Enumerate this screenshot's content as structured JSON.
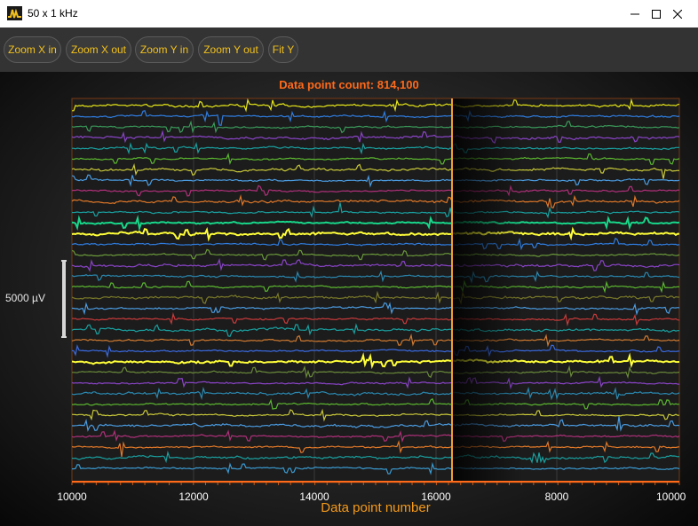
{
  "window": {
    "title": "50 x 1 kHz",
    "controls": [
      "minimize",
      "maximize",
      "close"
    ]
  },
  "toolbar": {
    "buttons": [
      "Zoom X in",
      "Zoom X out",
      "Zoom Y in",
      "Zoom Y out",
      "Fit Y"
    ]
  },
  "chart": {
    "count_label": "Data point count: 814,100",
    "scale_label": "5000 µV",
    "x_title": "Data point number",
    "tick_labels": [
      "10000",
      "12000",
      "14000",
      "16000",
      "8000",
      "10000"
    ]
  },
  "chart_data": {
    "type": "line",
    "title": "Data point count: 814,100",
    "xlabel": "Data point number",
    "ylabel": "",
    "sweep_axis": {
      "range": [
        6000,
        16000
      ],
      "wrap_at": 16272,
      "ticks_after_sweep": [
        10000,
        12000,
        14000,
        16000
      ],
      "ticks_before_sweep": [
        8000,
        10000
      ]
    },
    "channel_count": 50,
    "channel_colors": [
      "#e8e81a",
      "#2f7de0",
      "#3a9a5a",
      "#8a44c8",
      "#1aa0a0",
      "#5cb830",
      "#c8c83a",
      "#4a9be0",
      "#b0307a",
      "#e07828",
      "#1aa0a0",
      "#18d68a",
      "#ffff3a",
      "#2f7de0",
      "#6a9a3a",
      "#8a44c8",
      "#2a88b0",
      "#5cb830",
      "#7a7a2a",
      "#4a9be0",
      "#c83a3a",
      "#1aa0a0",
      "#d07a30",
      "#3a6ae0",
      "#ffff3a",
      "#6a8a3a",
      "#8a44c8",
      "#2a88b0",
      "#5cb830",
      "#c8c83a",
      "#4a9be0",
      "#b0307a",
      "#e07828",
      "#1aa0a0",
      "#3a9ad0"
    ],
    "scale_bar_uV": 5000
  }
}
